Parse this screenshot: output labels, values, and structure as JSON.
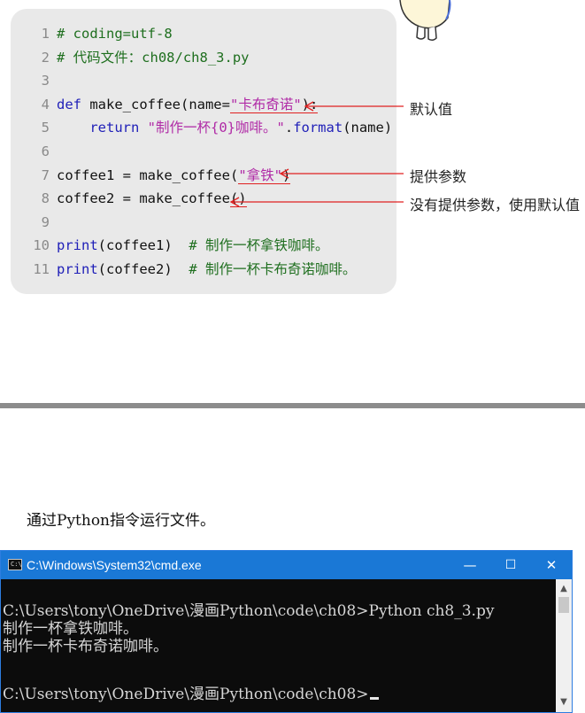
{
  "code": {
    "lines": [
      {
        "n": "1",
        "parts": [
          {
            "t": "# coding=utf-8",
            "c": "c"
          }
        ]
      },
      {
        "n": "2",
        "parts": [
          {
            "t": "# 代码文件：ch08/ch8_3.py",
            "c": "c"
          }
        ]
      },
      {
        "n": "3",
        "parts": []
      },
      {
        "n": "4",
        "parts": [
          {
            "t": "def",
            "c": "k"
          },
          {
            "t": " make_coffee(name="
          },
          {
            "t": "\"卡布奇诺\"",
            "c": "s",
            "u": true
          },
          {
            "t": "):",
            "u": true
          }
        ]
      },
      {
        "n": "5",
        "parts": [
          {
            "t": "    "
          },
          {
            "t": "return",
            "c": "k"
          },
          {
            "t": " "
          },
          {
            "t": "\"制作一杯{0}咖啡。\"",
            "c": "s"
          },
          {
            "t": "."
          },
          {
            "t": "format",
            "c": "k"
          },
          {
            "t": "(name)"
          }
        ]
      },
      {
        "n": "6",
        "parts": []
      },
      {
        "n": "7",
        "parts": [
          {
            "t": "coffee1 = make_coffee("
          },
          {
            "t": "\"拿铁\"",
            "c": "s",
            "u": true
          },
          {
            "t": ")",
            "u": true
          }
        ]
      },
      {
        "n": "8",
        "parts": [
          {
            "t": "coffee2 = make_coffee"
          },
          {
            "t": "()",
            "u": true
          }
        ]
      },
      {
        "n": "9",
        "parts": []
      },
      {
        "n": "10",
        "parts": [
          {
            "t": "print",
            "c": "k"
          },
          {
            "t": "(coffee1)  "
          },
          {
            "t": "# 制作一杯拿铁咖啡。",
            "c": "c"
          }
        ]
      },
      {
        "n": "11",
        "parts": [
          {
            "t": "print",
            "c": "k"
          },
          {
            "t": "(coffee2)  "
          },
          {
            "t": "# 制作一杯卡布奇诺咖啡。",
            "c": "c"
          }
        ]
      }
    ]
  },
  "annotations": {
    "default_value": "默认值",
    "provide_param": "提供参数",
    "no_param_use_default": "没有提供参数，使用默认值"
  },
  "caption": "通过Python指令运行文件。",
  "cmd": {
    "title": "C:\\Windows\\System32\\cmd.exe",
    "icon_text": "C:\\",
    "minimize": "—",
    "maximize": "☐",
    "close": "✕",
    "scroll_up": "▲",
    "scroll_down": "▼",
    "lines": {
      "command": "C:\\Users\\tony\\OneDrive\\漫画Python\\code\\ch08>Python ch8_3.py",
      "out1": "制作一杯拿铁咖啡。",
      "out2": "制作一杯卡布奇诺咖啡。",
      "prompt": "C:\\Users\\tony\\OneDrive\\漫画Python\\code\\ch08>"
    }
  },
  "colors": {
    "code_bg": "#e9e9e9",
    "keyword": "#1f1fb8",
    "comment": "#1f6f1f",
    "string": "#b02aa6",
    "arrow": "#e02020",
    "titlebar": "#1a78d6",
    "console_bg": "#0c0c0c"
  }
}
